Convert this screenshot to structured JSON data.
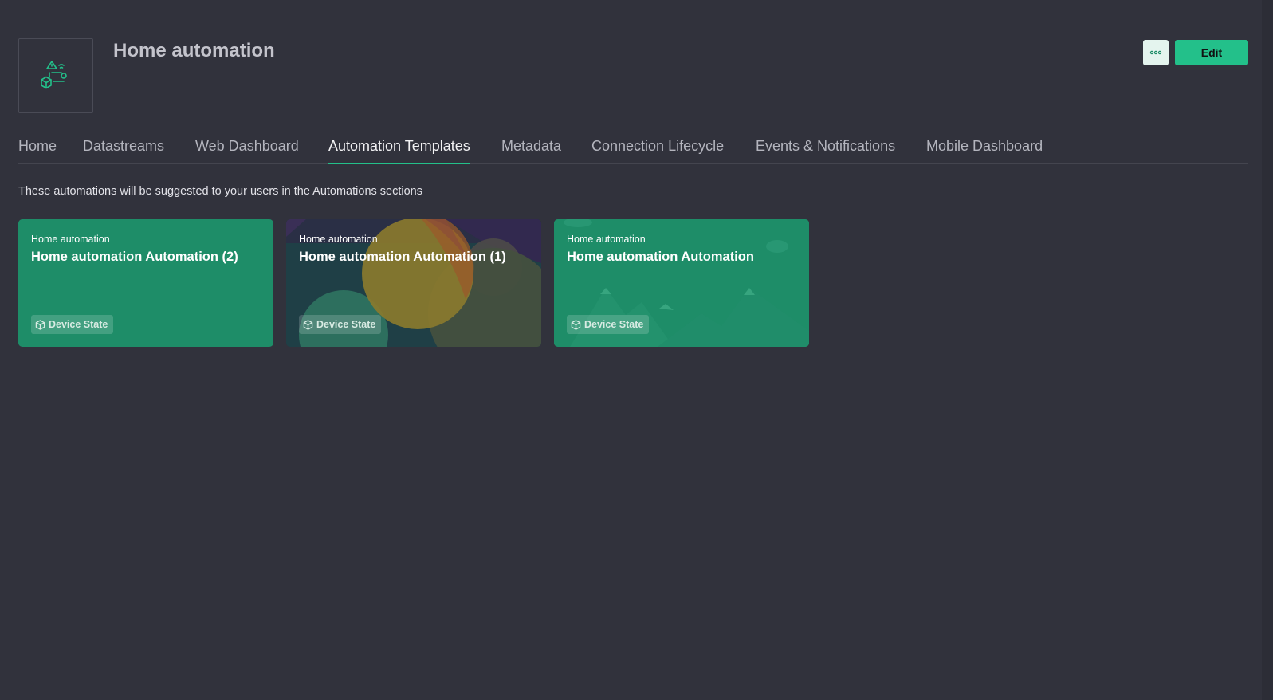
{
  "header": {
    "title": "Home automation",
    "edit_label": "Edit",
    "more_icon": "ellipsis-icon",
    "product_icon": "home-automation-icon"
  },
  "tabs": [
    {
      "label": "Home",
      "active": false
    },
    {
      "label": "Datastreams",
      "active": false
    },
    {
      "label": "Web Dashboard",
      "active": false
    },
    {
      "label": "Automation Templates",
      "active": true
    },
    {
      "label": "Metadata",
      "active": false
    },
    {
      "label": "Connection Lifecycle",
      "active": false
    },
    {
      "label": "Events & Notifications",
      "active": false
    },
    {
      "label": "Mobile Dashboard",
      "active": false
    }
  ],
  "description": "These automations will be suggested to your users in the Automations sections",
  "cards": [
    {
      "subtitle": "Home automation",
      "title": "Home automation Automation (2)",
      "tag": "Device State",
      "tag_icon": "cube-icon"
    },
    {
      "subtitle": "Home automation",
      "title": "Home automation Automation (1)",
      "tag": "Device State",
      "tag_icon": "cube-icon"
    },
    {
      "subtitle": "Home automation",
      "title": "Home automation Automation",
      "tag": "Device State",
      "tag_icon": "cube-icon"
    }
  ],
  "colors": {
    "background": "#31323c",
    "accent": "#23c08a",
    "card_green": "#1e8d68",
    "card_dark": "#1f3f46"
  }
}
